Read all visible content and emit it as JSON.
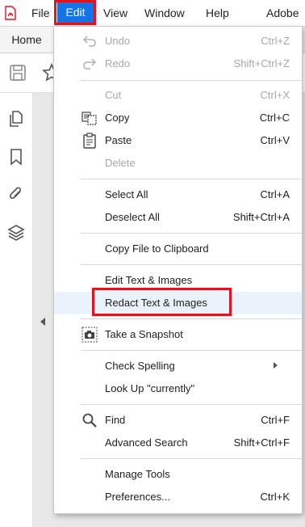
{
  "menubar": {
    "items": [
      "File",
      "Edit",
      "View",
      "Window",
      "Help",
      "Adobe"
    ]
  },
  "tabs": {
    "home": "Home"
  },
  "edit_menu": {
    "items": [
      {
        "label": "Undo",
        "shortcut": "Ctrl+Z",
        "disabled": true,
        "icon": "undo-icon"
      },
      {
        "label": "Redo",
        "shortcut": "Shift+Ctrl+Z",
        "disabled": true,
        "icon": "redo-icon"
      },
      {
        "label": "Cut",
        "shortcut": "Ctrl+X",
        "disabled": true
      },
      {
        "label": "Copy",
        "shortcut": "Ctrl+C",
        "disabled": false,
        "icon": "copy-icon"
      },
      {
        "label": "Paste",
        "shortcut": "Ctrl+V",
        "disabled": false,
        "icon": "paste-icon"
      },
      {
        "label": "Delete",
        "shortcut": "",
        "disabled": true
      },
      {
        "label": "Select All",
        "shortcut": "Ctrl+A",
        "disabled": false
      },
      {
        "label": "Deselect All",
        "shortcut": "Shift+Ctrl+A",
        "disabled": false
      },
      {
        "label": "Copy File to Clipboard",
        "shortcut": "",
        "disabled": false
      },
      {
        "label": "Edit Text & Images",
        "shortcut": "",
        "disabled": false
      },
      {
        "label": "Redact Text & Images",
        "shortcut": "",
        "disabled": false,
        "highlighted": true
      },
      {
        "label": "Take a Snapshot",
        "shortcut": "",
        "disabled": false,
        "icon": "camera-icon"
      },
      {
        "label": "Check Spelling",
        "shortcut": "",
        "disabled": false,
        "submenu": true
      },
      {
        "label": "Look Up \"currently\"",
        "shortcut": "",
        "disabled": false
      },
      {
        "label": "Find",
        "shortcut": "Ctrl+F",
        "disabled": false,
        "icon": "search-icon"
      },
      {
        "label": "Advanced Search",
        "shortcut": "Shift+Ctrl+F",
        "disabled": false
      },
      {
        "label": "Manage Tools",
        "shortcut": "",
        "disabled": false
      },
      {
        "label": "Preferences...",
        "shortcut": "Ctrl+K",
        "disabled": false
      }
    ]
  },
  "colors": {
    "accent": "#1473e6",
    "annotation": "#e0141e",
    "hover": "#eaf2fb",
    "disabled_text": "#a8a8a8"
  }
}
